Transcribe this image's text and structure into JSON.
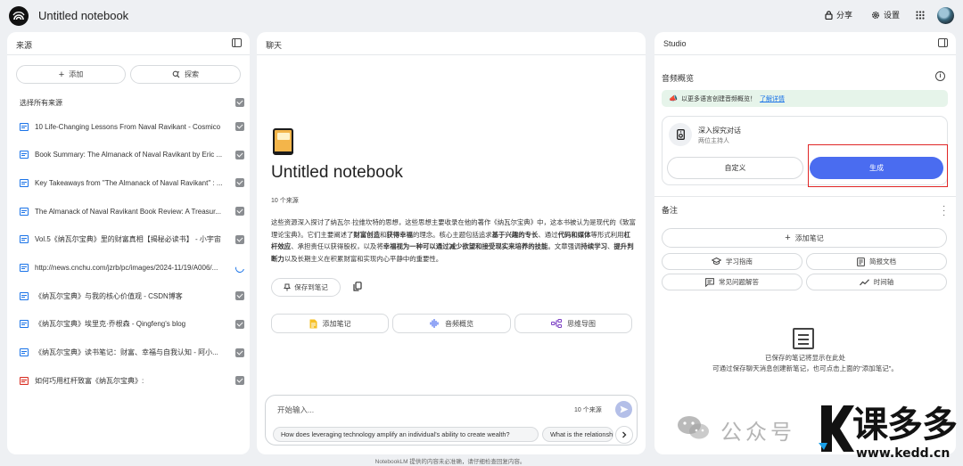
{
  "app": {
    "notebook_title": "Untitled notebook"
  },
  "topbar": {
    "share_label": "分享",
    "settings_label": "设置"
  },
  "sources": {
    "title": "来源",
    "add_label": "添加",
    "search_label": "探索",
    "select_all_label": "选择所有来源",
    "items": [
      {
        "title": "10 Life-Changing Lessons From Naval Ravikant - Cosmico",
        "icon": "web-doc-icon",
        "state": "checked"
      },
      {
        "title": "Book Summary: The Almanack of Naval Ravikant by Eric ...",
        "icon": "web-doc-icon",
        "state": "checked"
      },
      {
        "title": "Key Takeaways from \"The Almanack of Naval Ravikant\" : ...",
        "icon": "web-doc-icon",
        "state": "checked"
      },
      {
        "title": "The Almanack of Naval Ravikant Book Review: A Treasur...",
        "icon": "web-doc-icon",
        "state": "checked"
      },
      {
        "title": "Vol.5《纳瓦尔宝典》里的财富真相【揭秘必读书】 - 小宇宙",
        "icon": "web-doc-icon",
        "state": "checked"
      },
      {
        "title": "http://news.cnchu.com/jzrb/pc/images/2024-11/19/A006/...",
        "icon": "web-doc-icon",
        "state": "loading"
      },
      {
        "title": "《纳瓦尔宝典》与我的核心价值观 - CSDN博客",
        "icon": "web-doc-icon",
        "state": "checked"
      },
      {
        "title": "《纳瓦尔宝典》埃里克·乔根森 - Qingfeng's blog",
        "icon": "web-doc-icon",
        "state": "checked"
      },
      {
        "title": "《纳瓦尔宝典》读书笔记：财富、幸福与自我认知 - 阿小...",
        "icon": "web-doc-icon",
        "state": "checked"
      },
      {
        "title": "如何巧用杠杆致富《纳瓦尔宝典》:",
        "icon": "pdf-icon",
        "state": "checked"
      }
    ]
  },
  "chat": {
    "title": "聊天",
    "notebook_title": "Untitled notebook",
    "source_count": "10 个来源",
    "summary_parts": [
      {
        "text": "这些资源深入探讨了纳瓦尔·拉维坎特的思想，这些思想主要收录在他的著作《纳瓦尔宝典》中，这本书被认为是现代的《致富理论宝典》。它们主要阐述了",
        "bold": false
      },
      {
        "text": "财富创造",
        "bold": true
      },
      {
        "text": "和",
        "bold": false
      },
      {
        "text": "获得幸福",
        "bold": true
      },
      {
        "text": "的理念。核心主题包括追求",
        "bold": false
      },
      {
        "text": "基于兴趣的专长",
        "bold": true
      },
      {
        "text": "、通过",
        "bold": false
      },
      {
        "text": "代码和媒体",
        "bold": true
      },
      {
        "text": "等形式利用",
        "bold": false
      },
      {
        "text": "杠杆效应",
        "bold": true
      },
      {
        "text": "、承担责任以获得股权，以及将",
        "bold": false
      },
      {
        "text": "幸福视为一种可以通过减少欲望和接受现实来培养的技能",
        "bold": true
      },
      {
        "text": "。文章强调",
        "bold": false
      },
      {
        "text": "持续学习",
        "bold": true
      },
      {
        "text": "、",
        "bold": false
      },
      {
        "text": "提升判断力",
        "bold": true
      },
      {
        "text": "以及长期主义在积累财富和实现内心平静中的重要性。",
        "bold": false
      }
    ],
    "save_label": "保存到笔记",
    "actions": [
      {
        "label": "添加笔记",
        "icon": "note-icon"
      },
      {
        "label": "音频概览",
        "icon": "audio-wave-icon"
      },
      {
        "label": "思维导图",
        "icon": "mindmap-icon"
      }
    ],
    "input_placeholder": "开始输入...",
    "input_source_count": "10 个来源",
    "suggestions": [
      "How does leveraging technology amplify an individual's ability to create wealth?",
      "What is the relationship"
    ],
    "footer_note": "NotebookLM 提供的内容未必准确，请仔细检查回复内容。"
  },
  "studio": {
    "title": "Studio",
    "audio_title": "音频概览",
    "banner_text": "以更多语言创建音频概览！",
    "banner_link": "了解详情",
    "deep_title": "深入探究对话",
    "deep_sub": "两位主持人",
    "custom_label": "自定义",
    "generate_label": "生成",
    "notes_title": "备注",
    "add_note_label": "添加笔记",
    "note_buttons": [
      {
        "label": "学习指南",
        "icon": "study-guide-icon"
      },
      {
        "label": "简报文档",
        "icon": "briefing-doc-icon"
      },
      {
        "label": "常见问题解答",
        "icon": "faq-icon"
      },
      {
        "label": "时间轴",
        "icon": "timeline-icon"
      }
    ],
    "empty_line1": "已保存的笔记将显示在此处",
    "empty_line2": "可通过保存聊天消息创建新笔记，也可点击上面的\"添加笔记\"。"
  },
  "watermark": {
    "text": "公众号",
    "brand": "课多多",
    "url": "www.kedd.cn"
  },
  "colors": {
    "accent": "#4a6cf0",
    "highlight_box": "#e02626",
    "banner_bg": "#e6f4ea",
    "link": "#1a73e8"
  }
}
